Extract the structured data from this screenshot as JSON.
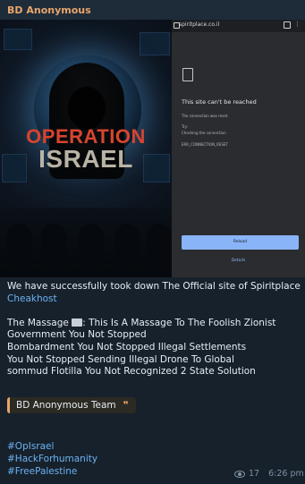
{
  "header": {
    "channel_name": "BD Anonymous"
  },
  "poster": {
    "line1": "OPERATION",
    "line2": "ISRAEL"
  },
  "browser": {
    "url": "spiritplace.co.il",
    "error_title": "This site can't be reached",
    "error_lines": [
      "The connection was reset.",
      "Try:",
      "Checking the connection",
      "ERR_CONNECTION_RESET"
    ],
    "reload_label": "Reload",
    "details_label": "Details"
  },
  "message": {
    "line1": "We have successfully took down The Official site of  Spiritplace",
    "link": "Cheakhost",
    "massage_prefix": "The Massage",
    "massage_rest": ": This Is A Massage To The Foolish Zionist",
    "line3": "Government You Not Stopped",
    "line4": "Bombardment You Not Stopped Illegal Settlements",
    "line5": "You Not Stopped Sending Illegal Drone To  Global",
    "line6": "sommud Flotilla  You Not Recognized 2 State Solution",
    "quote": "BD Anonymous Team",
    "quote_mark": "❞",
    "hashtags": [
      "#OpIsrael",
      "#HackForhumanity",
      "#FreePalestine"
    ]
  },
  "meta": {
    "views": "17",
    "time": "6:26 pm"
  }
}
